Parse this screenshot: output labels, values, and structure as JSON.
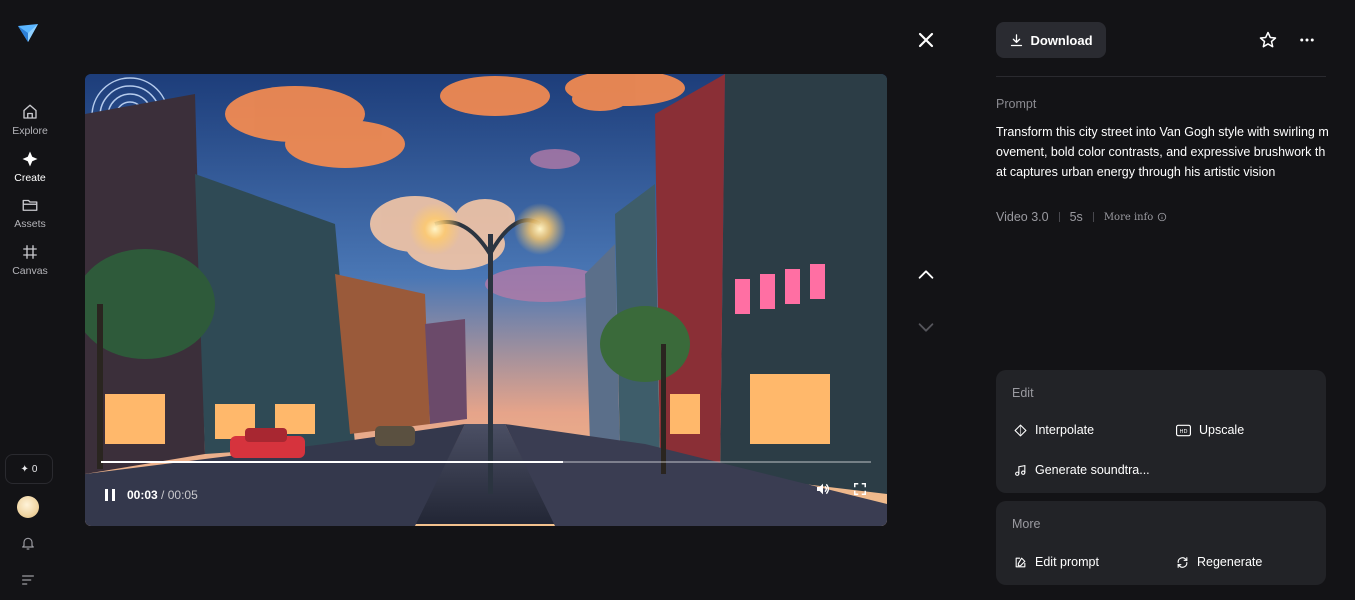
{
  "sidebar": {
    "items": [
      {
        "label": "Explore",
        "icon": "home-icon"
      },
      {
        "label": "Create",
        "icon": "sparkle-icon"
      },
      {
        "label": "Assets",
        "icon": "folder-icon"
      },
      {
        "label": "Canvas",
        "icon": "grid-hash-icon"
      }
    ],
    "credits": "0"
  },
  "player": {
    "time_current": "00:03",
    "time_total": "/ 00:05",
    "progress_fraction": 0.6
  },
  "panel": {
    "download_label": "Download",
    "prompt_heading": "Prompt",
    "prompt_text": "Transform this city street into Van Gogh style with swirling movement, bold color contrasts, and expressive brushwork that captures urban energy through his artistic vision",
    "model": "Video 3.0",
    "duration": "5s",
    "more_info": "More info",
    "edit": {
      "title": "Edit",
      "actions": [
        "Interpolate",
        "Upscale",
        "Generate soundtra..."
      ]
    },
    "more": {
      "title": "More",
      "actions": [
        "Edit prompt",
        "Regenerate"
      ]
    }
  },
  "colors": {
    "background": "#131316",
    "card": "#222327",
    "button": "#2a2b31",
    "accent_logo": "#4aa8ff"
  }
}
